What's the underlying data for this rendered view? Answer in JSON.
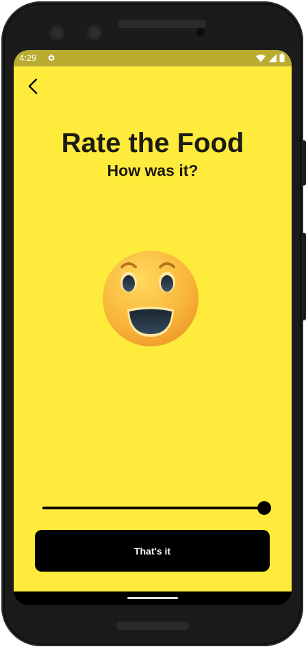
{
  "status_bar": {
    "time": "4:29",
    "background_color": "#b9ac2f",
    "icons": [
      "gear-icon",
      "wifi-icon",
      "signal-icon",
      "battery-icon"
    ]
  },
  "header": {
    "back_icon": "chevron-left-icon"
  },
  "main": {
    "title": "Rate the Food",
    "subtitle": "How was it?",
    "emoji": "grinning-face-icon",
    "background_color": "#ffeb3b"
  },
  "slider": {
    "value": 1.0,
    "min": 0,
    "max": 1
  },
  "actions": {
    "submit_label": "That's it"
  }
}
